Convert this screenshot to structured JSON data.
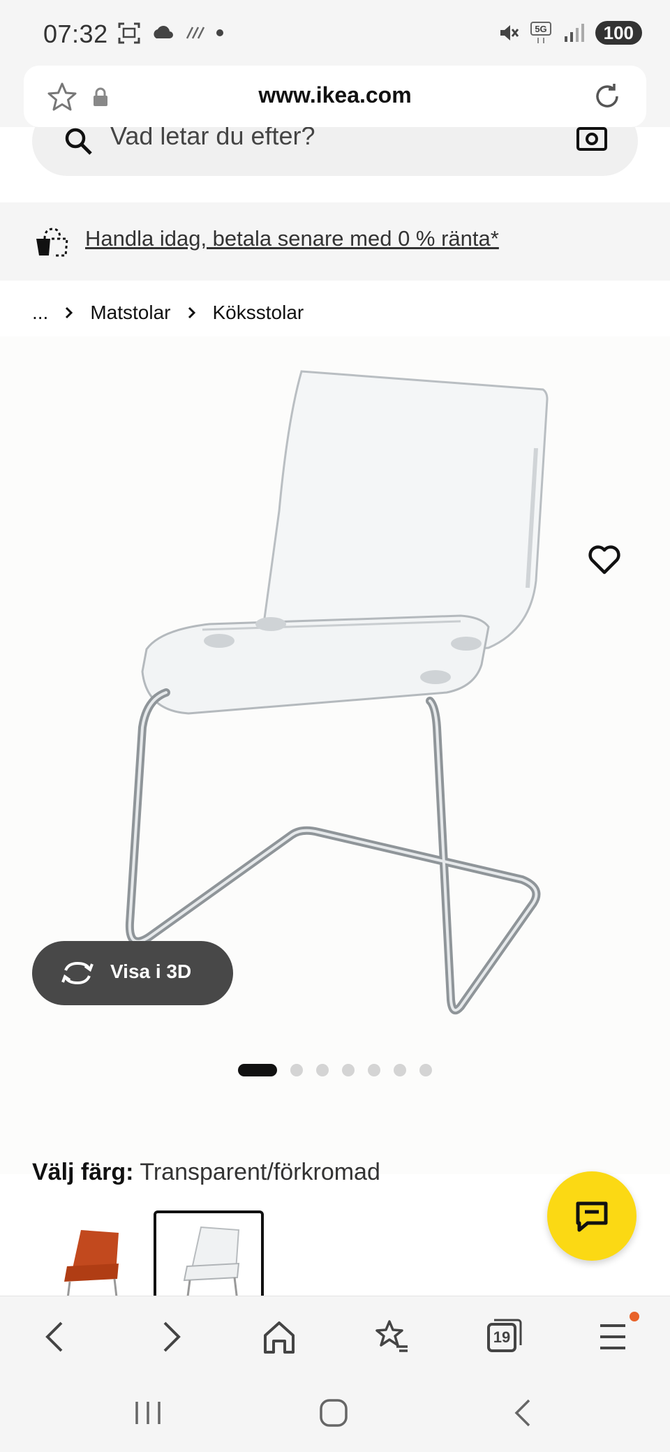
{
  "status_bar": {
    "time": "07:32",
    "battery": "100",
    "network": "5G"
  },
  "url_bar": {
    "url": "www.ikea.com"
  },
  "search": {
    "placeholder": "Vad letar du efter?"
  },
  "promo": {
    "text": "Handla idag, betala senare med 0 % ränta*"
  },
  "breadcrumb": {
    "ellipsis": "...",
    "items": [
      "Matstolar",
      "Köksstolar"
    ]
  },
  "product": {
    "view_3d_label": "Visa i 3D",
    "image_count": 7,
    "active_image_index": 0,
    "color_label": "Välj färg:",
    "color_value": "Transparent/förkromad"
  },
  "browser_toolbar": {
    "tab_count": "19"
  },
  "colors": {
    "accent_yellow": "#fbd914",
    "notification_orange": "#e8632a",
    "pill_dark": "#484848"
  },
  "icons": {
    "status_left": [
      "screenshot-icon",
      "gallery-icon",
      "cloud-icon",
      "signal-lines-icon",
      "dot-icon"
    ],
    "status_right": [
      "mute-icon",
      "5g-icon",
      "signal-icon",
      "battery-icon"
    ],
    "url_bar_left": [
      "star-icon",
      "lock-icon"
    ],
    "url_bar_right": [
      "reload-icon"
    ],
    "toolbar": [
      "back-icon",
      "forward-icon",
      "home-icon",
      "bookmarks-icon",
      "tabs-icon",
      "menu-icon"
    ]
  }
}
